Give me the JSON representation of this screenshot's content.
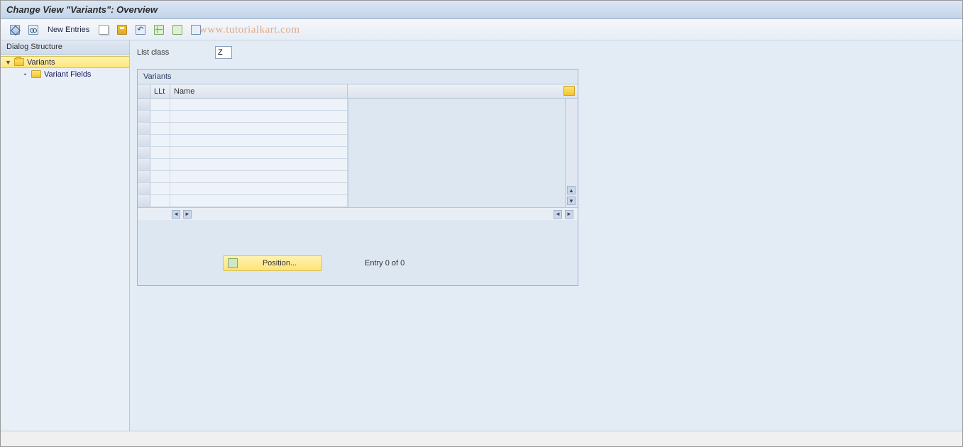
{
  "title": "Change View \"Variants\": Overview",
  "toolbar": {
    "new_entries": "New Entries"
  },
  "watermark": "www.tutorialkart.com",
  "sidebar": {
    "header": "Dialog Structure",
    "nodes": [
      {
        "label": "Variants",
        "selected": true,
        "expanded": true
      },
      {
        "label": "Variant Fields",
        "selected": false
      }
    ]
  },
  "content": {
    "list_class_label": "List class",
    "list_class_value": "Z",
    "panel_title": "Variants",
    "columns": {
      "llt": "LLt",
      "name": "Name"
    },
    "row_count": 9,
    "position_button": "Position...",
    "entry_text": "Entry 0 of 0"
  }
}
